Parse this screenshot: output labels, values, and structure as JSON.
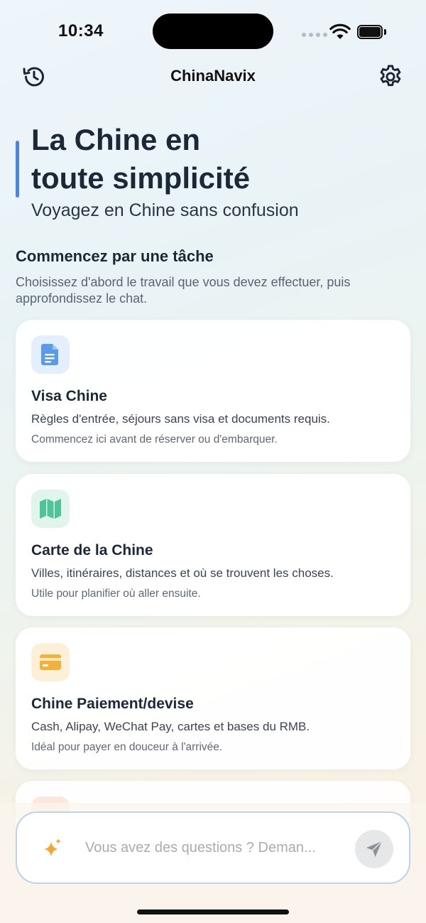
{
  "status": {
    "time": "10:34"
  },
  "nav": {
    "title": "ChinaNavix",
    "history_icon": "history-icon",
    "settings_icon": "gear-icon"
  },
  "hero": {
    "title_line1": "La Chine en",
    "title_line2": "toute simplicité",
    "subtitle": "Voyagez en Chine sans confusion",
    "accent_color": "#4a86e0"
  },
  "section": {
    "title": "Commencez par une tâche",
    "description": "Choisissez d'abord le travail que vous devez effectuer, puis approfondissez le chat."
  },
  "cards": [
    {
      "icon": "document-icon",
      "color": "#5a9be8",
      "tile": "#e3effc",
      "title": "Visa Chine",
      "description": "Règles d'entrée, séjours sans visa et documents requis.",
      "note": "Commencez ici avant de réserver ou d'embarquer."
    },
    {
      "icon": "map-icon",
      "color": "#4fc39a",
      "tile": "#e1f5ed",
      "title": "Carte de la Chine",
      "description": "Villes, itinéraires, distances et où se trouvent les choses.",
      "note": "Utile pour planifier où aller ensuite."
    },
    {
      "icon": "credit-card-icon",
      "color": "#f2b13a",
      "tile": "#fdf0d8",
      "title": "Chine Paiement/devise",
      "description": "Cash, Alipay, WeChat Pay, cartes et bases du RMB.",
      "note": "Idéal pour payer en douceur à l'arrivée."
    }
  ],
  "chat": {
    "placeholder": "Vous avez des questions ? Deman...",
    "sparkle_icon": "sparkle-icon",
    "send_icon": "send-icon"
  }
}
